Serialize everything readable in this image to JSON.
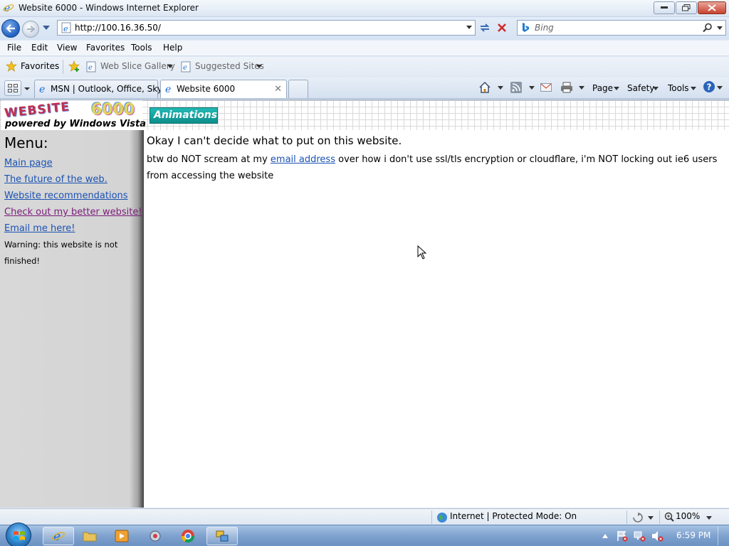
{
  "window": {
    "title": "Website 6000 - Windows Internet Explorer"
  },
  "address": {
    "url": "http://100.16.36.50/"
  },
  "search": {
    "placeholder": "Bing"
  },
  "menu": [
    "File",
    "Edit",
    "View",
    "Favorites",
    "Tools",
    "Help"
  ],
  "favorites_bar": {
    "favorites": "Favorites",
    "web_slice": "Web Slice Gallery",
    "suggested": "Suggested Sites"
  },
  "tabs": [
    {
      "label": "MSN | Outlook, Office, Sky..."
    },
    {
      "label": "Website 6000"
    }
  ],
  "command_bar": {
    "page": "Page",
    "safety": "Safety",
    "tools": "Tools"
  },
  "page": {
    "logo_top": "WEBSITE",
    "logo_number": "6000",
    "logo_sub": "powered by Windows Vista",
    "animations_label": "Animations",
    "menu_title": "Menu:",
    "menu_links": [
      "Main page",
      "The future of the web.",
      "Website recommendations",
      "Check out my better website!",
      "Email me here!"
    ],
    "warning": "Warning: this website is not finished!",
    "heading": "Okay I can't decide what to put on this website.",
    "para_before": "btw do NOT scream at my ",
    "para_link": "email address",
    "para_after": " over how i don't use ssl/tls encryption or cloudflare, i'm NOT locking out ie6 users from accessing the website"
  },
  "status": {
    "zone": "Internet | Protected Mode: On",
    "zoom": "100%"
  },
  "taskbar": {
    "clock": "6:59 PM"
  },
  "colors": {
    "link": "#1a52b4",
    "visited": "#7a1b7a",
    "accent_teal": "#0c8e8b"
  }
}
